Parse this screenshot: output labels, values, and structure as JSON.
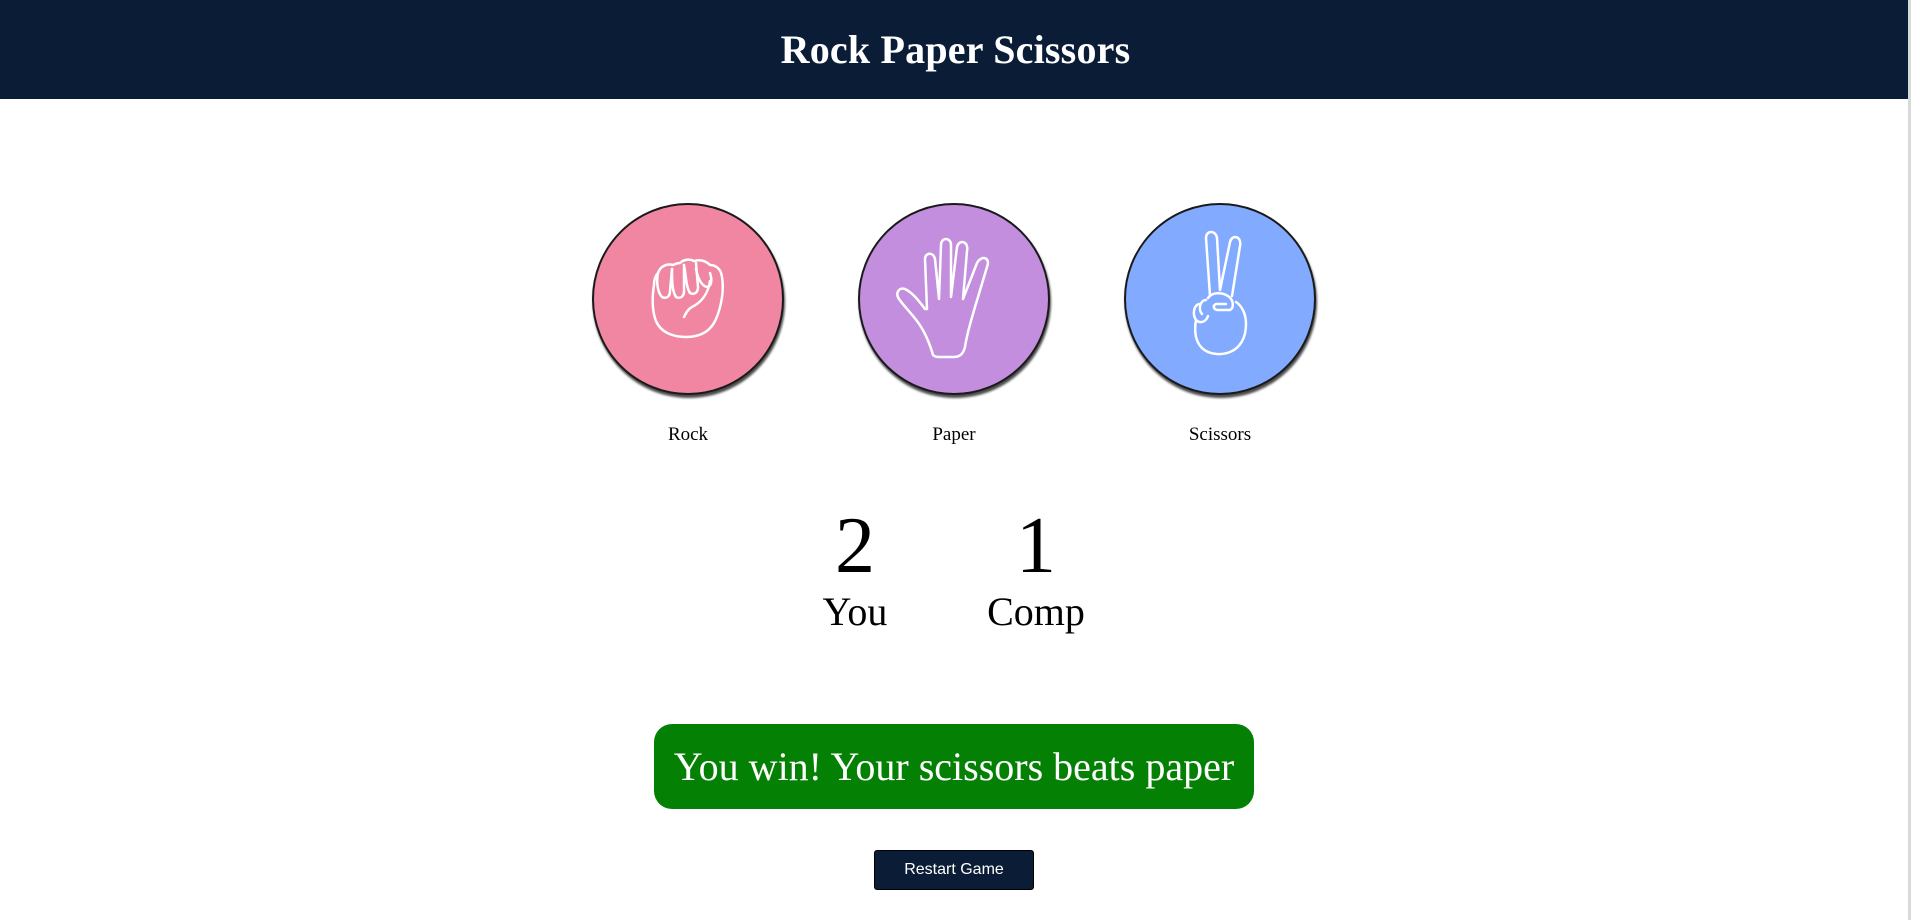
{
  "header": {
    "title": "Rock Paper Scissors"
  },
  "choices": [
    {
      "id": "rock",
      "label": "Rock",
      "icon": "rock-fist-icon",
      "color": "#f086a2"
    },
    {
      "id": "paper",
      "label": "Paper",
      "icon": "paper-hand-icon",
      "color": "#c28edd"
    },
    {
      "id": "scissors",
      "label": "Scissors",
      "icon": "scissors-hand-icon",
      "color": "#82aaff"
    }
  ],
  "scoreboard": {
    "user": {
      "score": "2",
      "label": "You"
    },
    "comp": {
      "score": "1",
      "label": "Comp"
    }
  },
  "result": {
    "message": "You win! Your scissors beats paper",
    "color": "#048004"
  },
  "restart": {
    "label": "Restart Game"
  },
  "colors": {
    "header_bg": "#0b1d36",
    "icon_stroke": "#ffffff"
  }
}
